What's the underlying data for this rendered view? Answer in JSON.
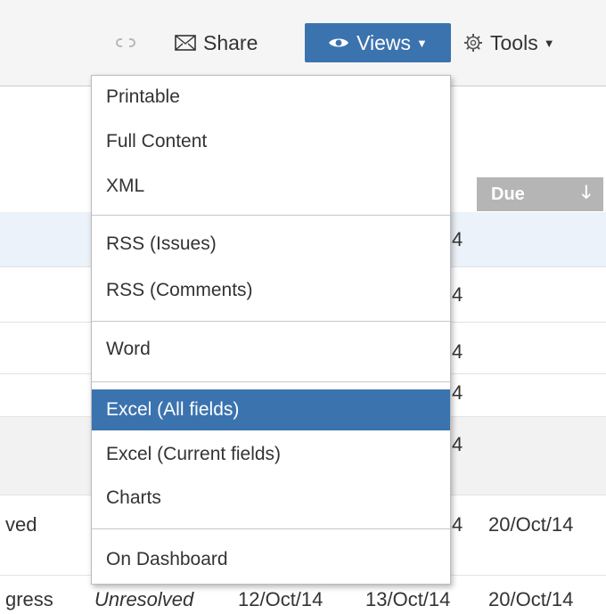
{
  "toolbar": {
    "share_label": "Share",
    "views_label": "Views",
    "tools_label": "Tools",
    "views_bg": "#3b73af"
  },
  "table": {
    "due_header": "Due",
    "partial_left": {
      "row6": "ved",
      "row7": "gress"
    },
    "row6": {
      "updated": "4",
      "due": "20/Oct/14"
    },
    "row7": {
      "resolution": "Unresolved",
      "created": "12/Oct/14",
      "updated": "13/Oct/14",
      "due": "20/Oct/14"
    },
    "peek_4": "4"
  },
  "views_menu": {
    "items": [
      {
        "label": "Printable"
      },
      {
        "label": "Full Content"
      },
      {
        "label": "XML"
      },
      {
        "label": "RSS (Issues)"
      },
      {
        "label": "RSS (Comments)"
      },
      {
        "label": "Word"
      },
      {
        "label": "Excel (All fields)",
        "active": true
      },
      {
        "label": "Excel (Current fields)"
      },
      {
        "label": "Charts"
      },
      {
        "label": "On Dashboard"
      }
    ],
    "active_bg": "#3b73af"
  }
}
